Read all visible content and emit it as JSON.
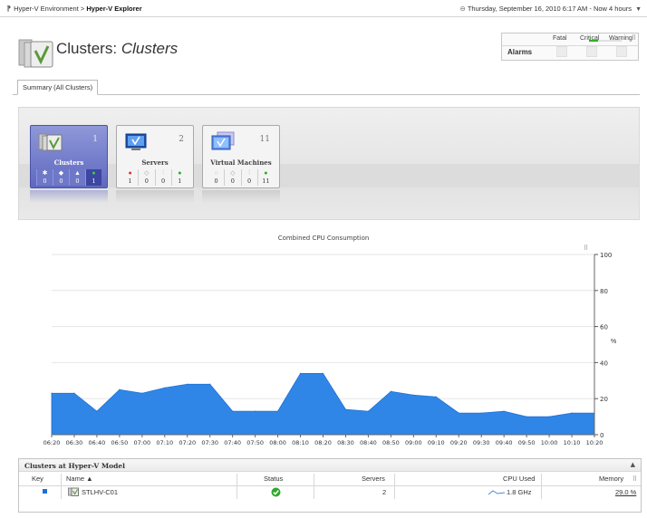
{
  "breadcrumb": {
    "parent": "Hyper-V Environment",
    "separator": ">",
    "current": "Hyper-V Explorer"
  },
  "timebar": {
    "text": "Thursday, September 16, 2010 6:17 AM - Now 4 hours"
  },
  "header": {
    "title_prefix": "Clusters:",
    "title_italic": "Clusters"
  },
  "alarms": {
    "label": "Alarms",
    "columns": [
      "Fatal",
      "Critical",
      "Warning"
    ]
  },
  "tabs": [
    {
      "label": "Summary (All Clusters)"
    }
  ],
  "tiles": [
    {
      "label": "Clusters",
      "count": "1",
      "stats": [
        "0",
        "0",
        "0",
        "1"
      ]
    },
    {
      "label": "Servers",
      "count": "2",
      "stats": [
        "1",
        "0",
        "0",
        "1"
      ]
    },
    {
      "label": "Virtual Machines",
      "count": "11",
      "stats": [
        "0",
        "0",
        "0",
        "11"
      ]
    }
  ],
  "chart_data": {
    "type": "area",
    "title": "Combined CPU Consumption",
    "ylabel": "%",
    "ylim": [
      0,
      100
    ],
    "yticks": [
      "0",
      "20",
      "40",
      "60",
      "80",
      "100"
    ],
    "x": [
      "06:20",
      "06:30",
      "06:40",
      "06:50",
      "07:00",
      "07:10",
      "07:20",
      "07:30",
      "07:40",
      "07:50",
      "08:00",
      "08:10",
      "08:20",
      "08:30",
      "08:40",
      "08:50",
      "09:00",
      "09:10",
      "09:20",
      "09:30",
      "09:40",
      "09:50",
      "10:00",
      "10:10",
      "10:20"
    ],
    "series": [
      {
        "values": [
          23,
          23,
          13,
          25,
          23,
          26,
          28,
          28,
          13,
          13,
          13,
          34,
          34,
          14,
          13,
          24,
          22,
          21,
          12,
          12,
          13,
          10,
          10,
          12,
          12
        ]
      }
    ],
    "color": "#2f86e6",
    "grid": true
  },
  "grid": {
    "title": "Clusters at Hyper-V Model",
    "columns": {
      "key": "Key",
      "name": "Name",
      "status": "Status",
      "servers": "Servers",
      "cpu": "CPU Used",
      "memory": "Memory"
    },
    "sort_indicator": "▲",
    "rows": [
      {
        "name": "STLHV-C01",
        "servers": "2",
        "cpu": "1.8 GHz",
        "memory": "29.0 %",
        "memory_fraction": 0.29,
        "status": "ok"
      }
    ]
  }
}
